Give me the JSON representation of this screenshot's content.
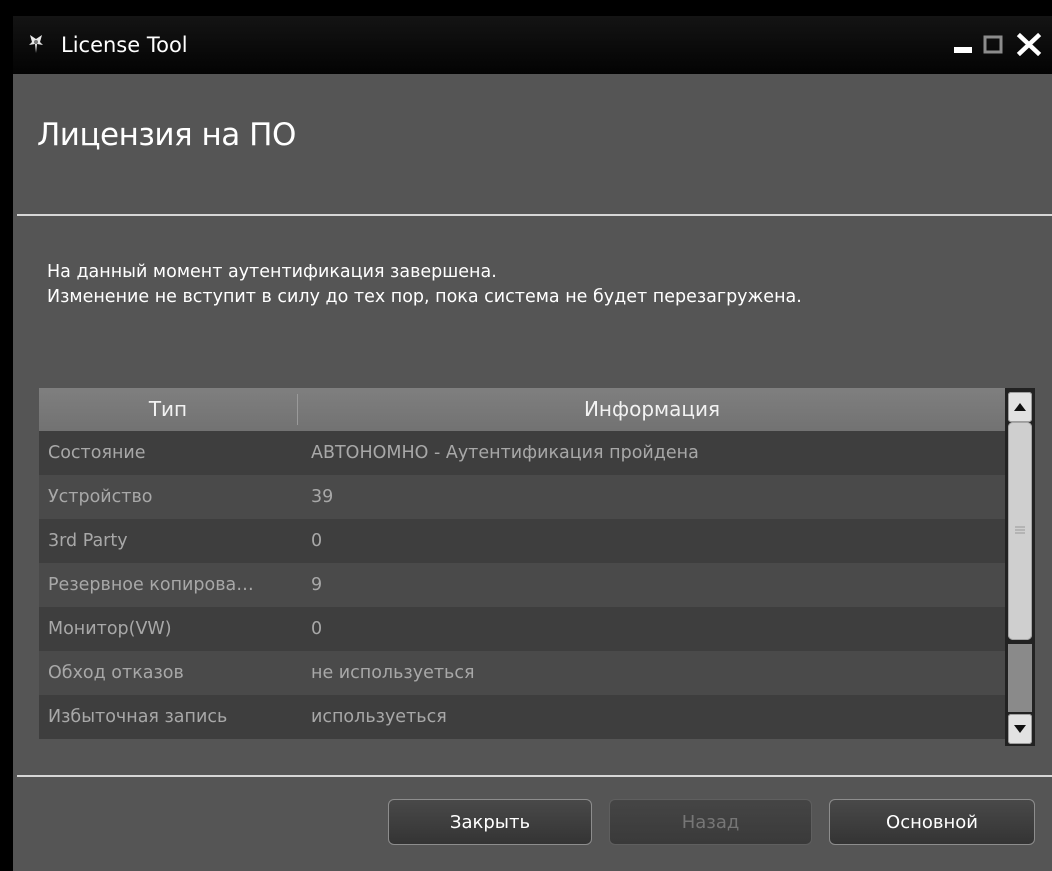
{
  "window": {
    "title": "License Tool",
    "heading": "Лицензия на ПО"
  },
  "message": {
    "line1": "На данный момент аутентификация завершена.",
    "line2": "Изменение не вступит в силу до тех пор, пока система не будет перезагружена."
  },
  "table": {
    "columns": {
      "type": "Тип",
      "info": "Информация"
    },
    "rows": [
      {
        "type": "Состояние",
        "info": "АВТОНОМНО - Аутентификация пройдена"
      },
      {
        "type": "Устройство",
        "info": "39"
      },
      {
        "type": "3rd Party",
        "info": "0"
      },
      {
        "type": "Резервное копирова…",
        "info": "9"
      },
      {
        "type": "Монитор(VW)",
        "info": "0"
      },
      {
        "type": "Обход отказов",
        "info": "не используеться"
      },
      {
        "type": "Избыточная запись",
        "info": "используеться"
      }
    ]
  },
  "buttons": {
    "close": "Закрыть",
    "back": "Назад",
    "main": "Основной"
  },
  "icons": {
    "app": "license-app-icon",
    "minimize": "minimize-icon",
    "maximize": "maximize-icon",
    "close": "close-icon",
    "scroll_up": "arrow-up-icon",
    "scroll_down": "arrow-down-icon",
    "grip": "grip-icon"
  },
  "colors": {
    "window_bg": "#555555",
    "titlebar_bg": "#0a0a0a",
    "row_dark": "#3e3e3e",
    "row_light": "#4a4a4a",
    "text_muted": "#a8a8a8"
  }
}
